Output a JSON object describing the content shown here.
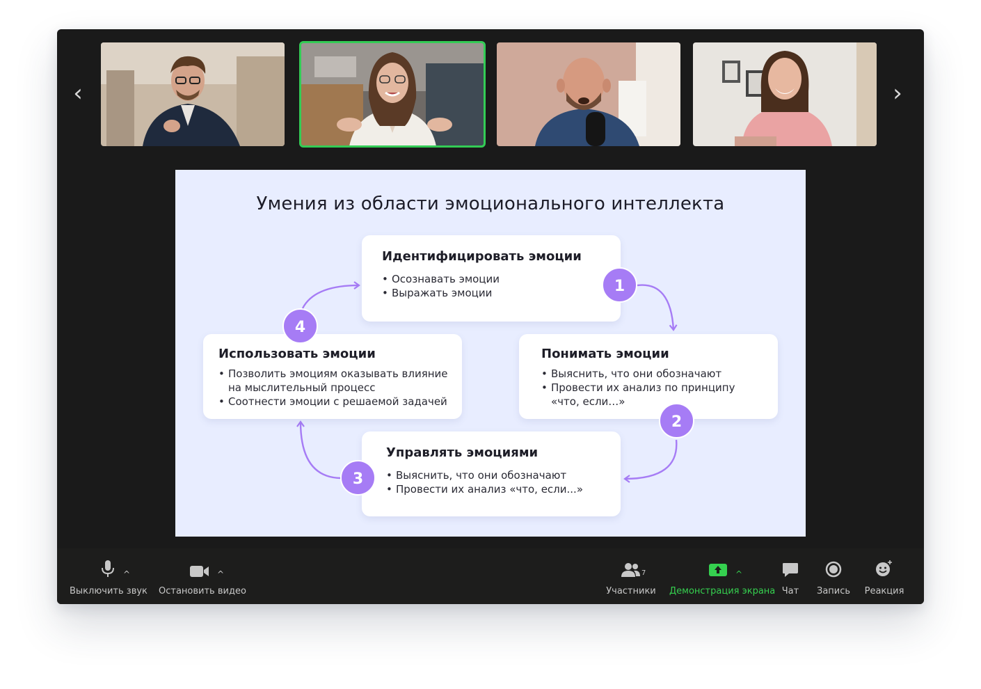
{
  "participants": [
    {
      "id": "p1",
      "active": false
    },
    {
      "id": "p2",
      "active": true
    },
    {
      "id": "p3",
      "active": false
    },
    {
      "id": "p4",
      "active": false
    }
  ],
  "nav": {
    "prev_icon": "chevron-left-icon",
    "next_icon": "chevron-right-icon",
    "prev": "‹",
    "next": "›"
  },
  "slide": {
    "title": "Умения из области эмоционального интеллекта",
    "accent": "#a67cf5",
    "background": "#e8edff",
    "cards": [
      {
        "title": "Идентифицировать эмоции",
        "items": [
          "Осознавать эмоции",
          "Выражать эмоции"
        ],
        "badge": "1"
      },
      {
        "title": "Понимать эмоции",
        "items": [
          "Выяснить, что они обозначают",
          "Провести их анализ по принципу «что, если…»"
        ],
        "badge": "2"
      },
      {
        "title": "Управлять эмоциями",
        "items": [
          "Выяснить, что они обозначают",
          "Провести их анализ «что, если...»"
        ],
        "badge": "3"
      },
      {
        "title": "Использовать эмоции",
        "items": [
          "Позволить эмоциям оказывать влияние на мыслительный процесс",
          "Соотнести эмоции с решаемой задачей"
        ],
        "badge": "4"
      }
    ]
  },
  "toolbar": {
    "mute": "Выключить звук",
    "video": "Остановить видео",
    "participants": "Участники",
    "participants_count": "7",
    "share": "Демонстрация экрана",
    "chat": "Чат",
    "record": "Запись",
    "reactions": "Реакция",
    "caret": "^",
    "share_color": "#35d04f"
  }
}
